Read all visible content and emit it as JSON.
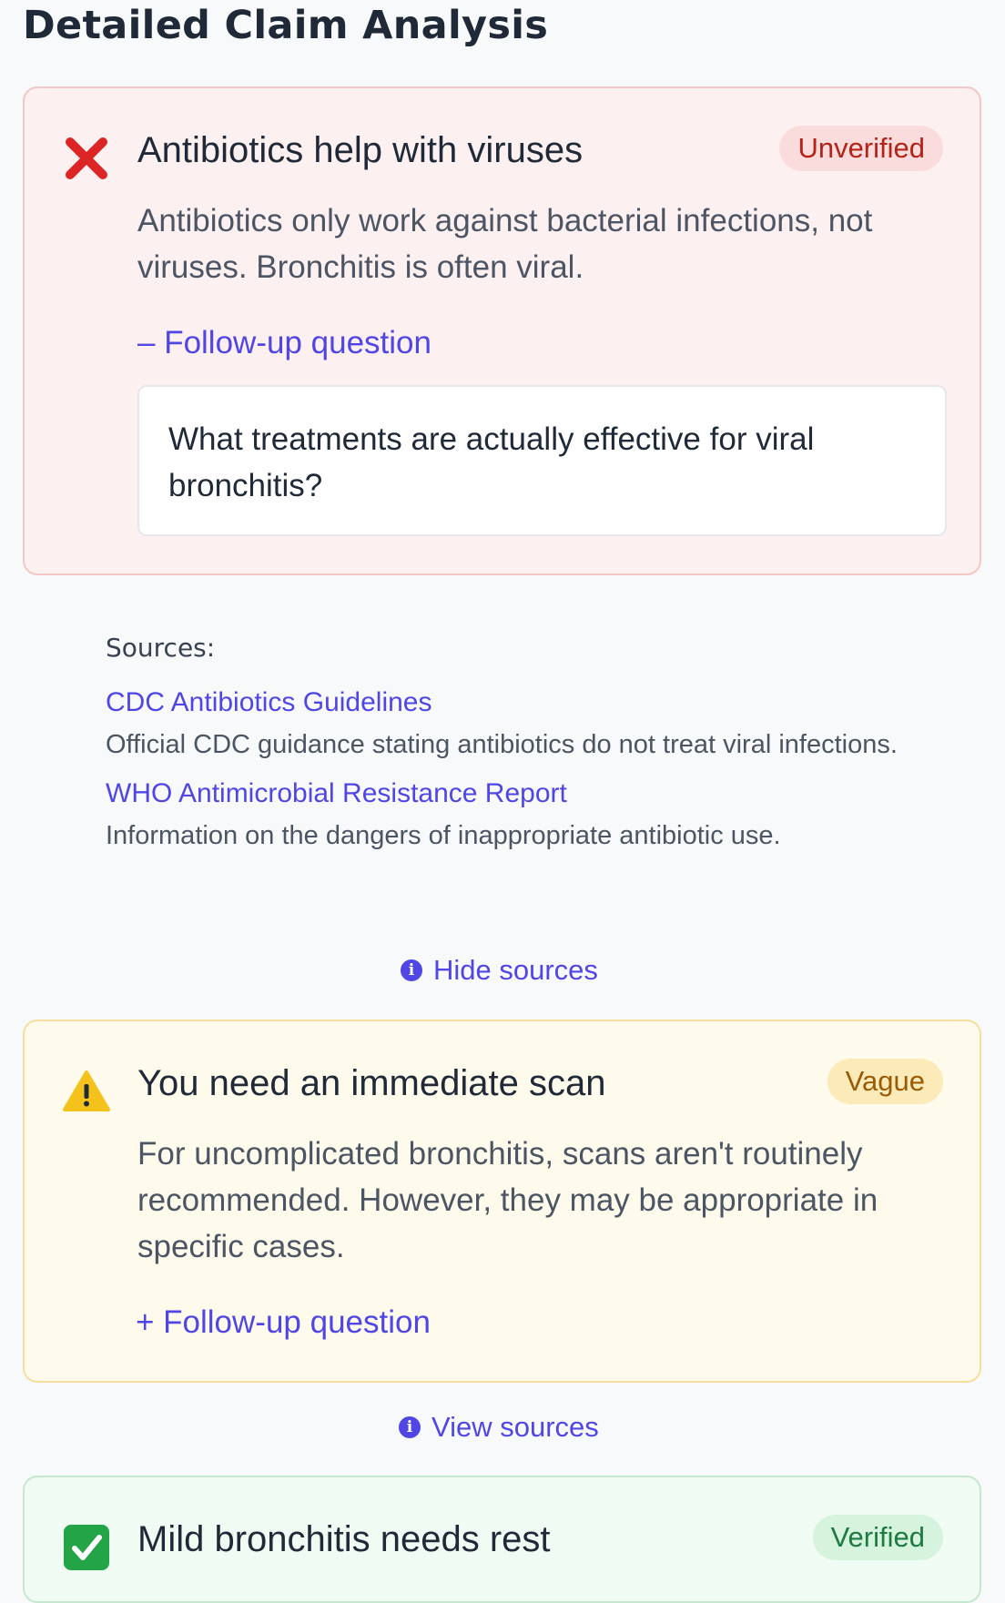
{
  "page": {
    "title": "Detailed Claim Analysis"
  },
  "claims": [
    {
      "status_icon": "cross-mark-icon",
      "title": "Antibiotics help with viruses",
      "badge": "Unverified",
      "badge_color": "#b42318",
      "explanation": "Antibiotics only work against bacterial infections, not viruses. Bronchitis is often viral.",
      "followup_toggle": "– Follow-up question",
      "followup_question": "What treatments are actually effective for viral bronchitis?",
      "sources": {
        "heading": "Sources:",
        "items": [
          {
            "title": "CDC Antibiotics Guidelines",
            "description": "Official CDC guidance stating antibiotics do not treat viral infections."
          },
          {
            "title": "WHO Antimicrobial Resistance Report",
            "description": "Information on the dangers of inappropriate antibiotic use."
          }
        ],
        "toggle_label": "Hide sources"
      }
    },
    {
      "status_icon": "warning-icon",
      "title": "You need an immediate scan",
      "badge": "Vague",
      "badge_color": "#9a5b07",
      "explanation": "For uncomplicated bronchitis, scans aren't routinely recommended. However, they may be appropriate in specific cases.",
      "followup_toggle": "+ Follow-up question",
      "sources": {
        "toggle_label": "View sources"
      }
    },
    {
      "status_icon": "check-mark-icon",
      "title": "Mild bronchitis needs rest",
      "badge": "Verified",
      "badge_color": "#1f7a3f"
    }
  ],
  "colors": {
    "accent": "#4f46e5",
    "unverified_bg": "#fdf0f0",
    "vague_bg": "#fefbec",
    "verified_bg": "#f0fbf3"
  }
}
